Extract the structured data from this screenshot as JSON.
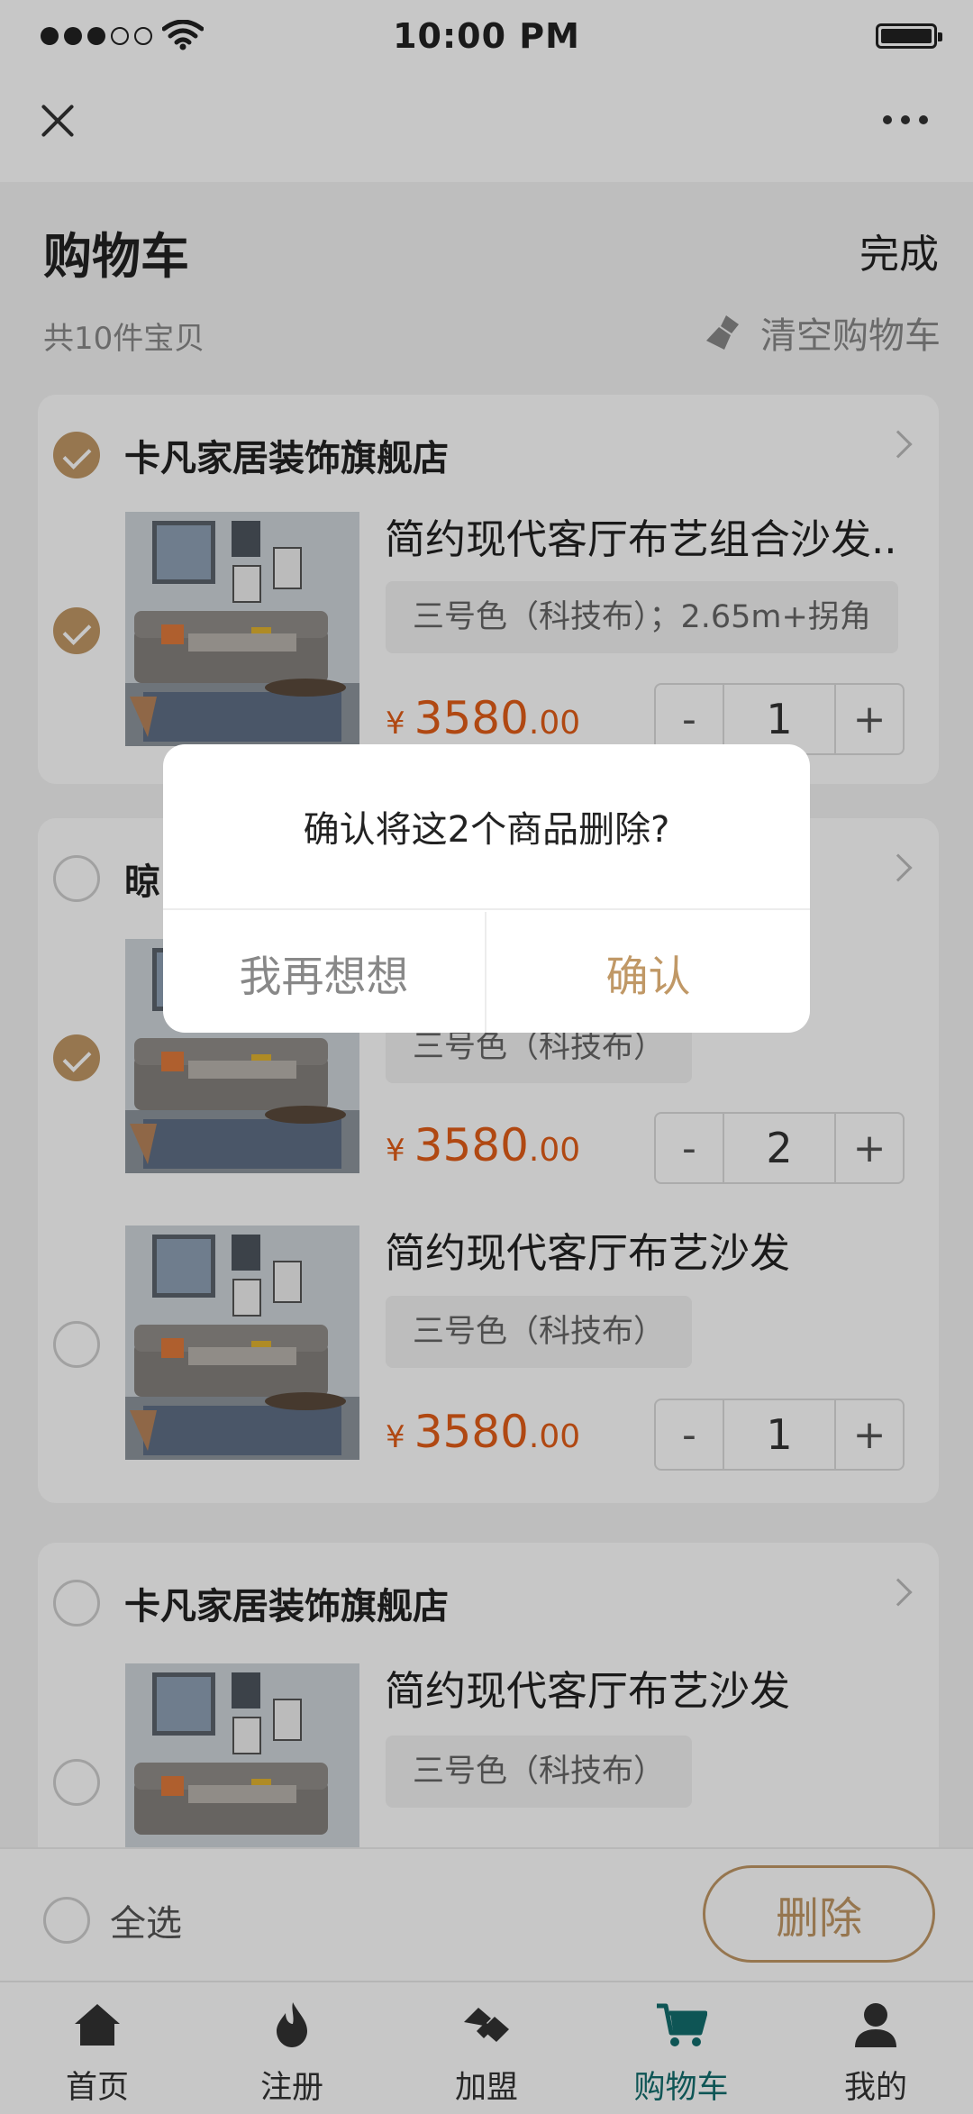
{
  "status_bar": {
    "time": "10:00 PM"
  },
  "header": {
    "title": "购物车",
    "done_label": "完成",
    "count_label": "共10件宝贝",
    "clear_label": "清空购物车"
  },
  "stores": [
    {
      "name": "卡凡家居装饰旗舰店",
      "checked": true,
      "items": [
        {
          "title": "简约现代客厅布艺组合沙发..",
          "spec": "三号色（科技布）；2.65m+拐角",
          "currency": "¥",
          "price_int": "3580",
          "price_dec": ".00",
          "qty": "1",
          "checked": true
        }
      ]
    },
    {
      "name": "晾",
      "checked": false,
      "items": [
        {
          "title": "",
          "spec": "三号色（科技布）",
          "currency": "¥",
          "price_int": "3580",
          "price_dec": ".00",
          "qty": "2",
          "checked": true
        },
        {
          "title": "简约现代客厅布艺沙发",
          "spec": "三号色（科技布）",
          "currency": "¥",
          "price_int": "3580",
          "price_dec": ".00",
          "qty": "1",
          "checked": false
        }
      ]
    },
    {
      "name": "卡凡家居装饰旗舰店",
      "checked": false,
      "items": [
        {
          "title": "简约现代客厅布艺沙发",
          "spec": "三号色（科技布）",
          "checked": false
        }
      ]
    }
  ],
  "qty_controls": {
    "minus": "-",
    "plus": "+"
  },
  "bottom_bar": {
    "select_all_label": "全选",
    "delete_label": "删除"
  },
  "tabs": [
    {
      "label": "首页",
      "icon": "home-icon"
    },
    {
      "label": "注册",
      "icon": "flame-icon"
    },
    {
      "label": "加盟",
      "icon": "handshake-icon"
    },
    {
      "label": "购物车",
      "icon": "cart-icon",
      "active": true
    },
    {
      "label": "我的",
      "icon": "user-icon"
    }
  ],
  "dialog": {
    "message": "确认将这2个商品删除?",
    "cancel_label": "我再想想",
    "confirm_label": "确认"
  },
  "colors": {
    "accent": "#c09866",
    "price": "#e25d18",
    "tab_active": "#136d6e"
  }
}
